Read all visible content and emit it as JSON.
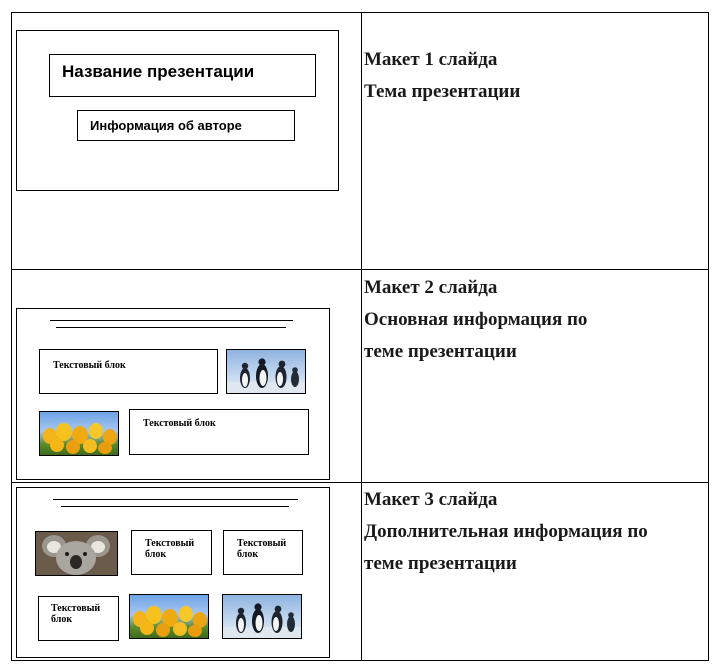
{
  "rows": [
    {
      "title": "Макет 1 слайда",
      "subtitle_lines": [
        "Тема презентации"
      ],
      "slide": {
        "title_box": "Название презентации",
        "author_box": "Информация  об авторе"
      }
    },
    {
      "title": "Макет 2 слайда",
      "subtitle_lines": [
        "Основная информация по",
        "теме презентации"
      ],
      "slide": {
        "textbox_1": "Текстовый блок",
        "textbox_2": "Текстовый блок"
      }
    },
    {
      "title": "Макет 3 слайда",
      "subtitle_lines": [
        "Дополнительная информация по",
        "теме презентации"
      ],
      "slide": {
        "textbox_1_line1": "Текстовый",
        "textbox_1_line2": "блок",
        "textbox_2_line1": "Текстовый",
        "textbox_2_line2": "блок",
        "textbox_3_line1": "Текстовый",
        "textbox_3_line2": "блок"
      }
    }
  ],
  "images": {
    "penguins": "penguins-photo",
    "tulips": "yellow-tulips-photo",
    "koala": "koala-photo"
  }
}
